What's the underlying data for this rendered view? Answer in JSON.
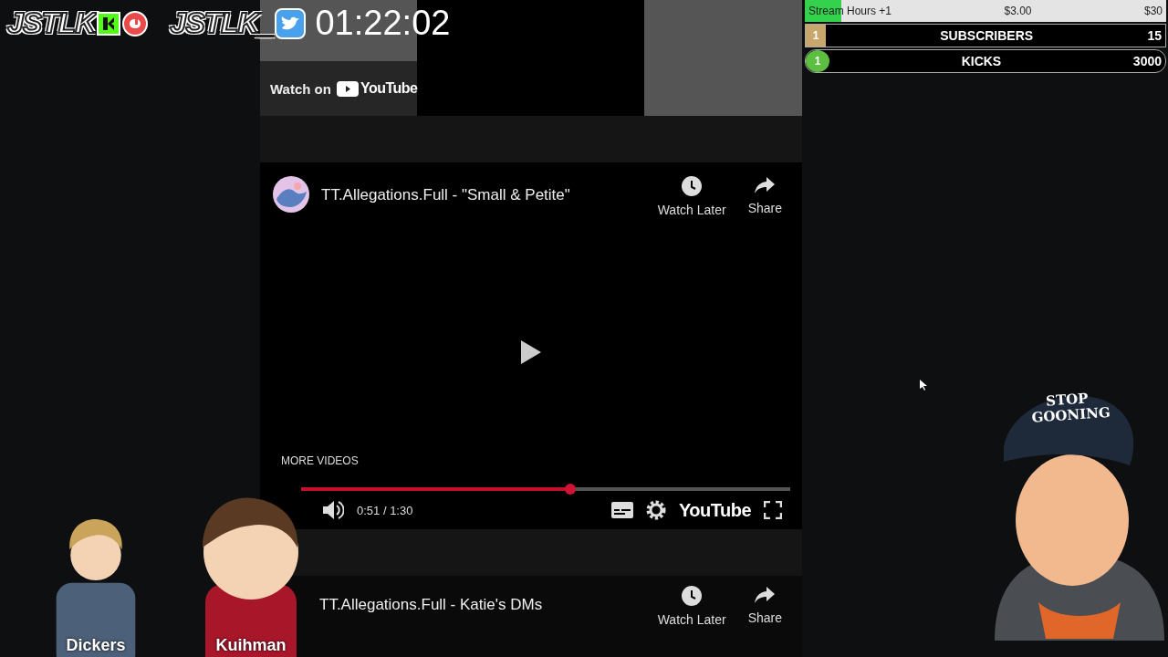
{
  "overlay": {
    "channels": [
      {
        "name": "JSTLK",
        "kind": "kick"
      },
      {
        "name": "JSTLK_",
        "kind": "twitter"
      }
    ],
    "timer": "01:22:02"
  },
  "goals": {
    "bar": {
      "label": "Stream Hours +1",
      "amount": "$3.00",
      "target": "$30",
      "level": 0.1
    },
    "counters": [
      {
        "kind": "square",
        "count": "1",
        "label": "SUBSCRIBERS",
        "value": "15",
        "color": "#c8a76c"
      },
      {
        "kind": "round",
        "count": "1",
        "label": "KICKS",
        "value": "3000",
        "color": "#5cbf3f"
      }
    ]
  },
  "videos": [
    {
      "kind": "ended",
      "watch_on": "Watch on",
      "brand": "YouTube"
    },
    {
      "kind": "player",
      "title": "TT.Allegations.Full - \"Small & Petite\"",
      "actions": [
        {
          "kind": "clock",
          "label": "Watch Later"
        },
        {
          "kind": "share",
          "label": "Share"
        }
      ],
      "more_videos": "MORE VIDEOS",
      "level": 0.55,
      "time": "0:51 / 1:30",
      "brand": "YouTube"
    },
    {
      "kind": "preview",
      "title": "TT.Allegations.Full - Katie's DMs",
      "actions": [
        {
          "kind": "clock",
          "label": "Watch Later"
        },
        {
          "kind": "share",
          "label": "Share"
        }
      ]
    }
  ],
  "characters": [
    {
      "name": "Dickers",
      "kind": "blond"
    },
    {
      "name": "Kuihman",
      "kind": "hoodie"
    }
  ],
  "mascot": {
    "hat_text": [
      "STOP",
      "GOONING"
    ]
  }
}
